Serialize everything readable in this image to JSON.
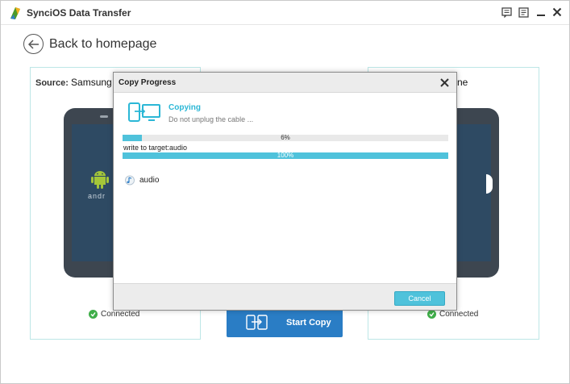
{
  "window": {
    "title": "SynciOS Data Transfer"
  },
  "nav": {
    "back_label": "Back to homepage"
  },
  "source_panel": {
    "label_prefix": "Source:",
    "device_name": "Samsung",
    "status": "Connected",
    "os_text": "andr"
  },
  "target_panel": {
    "label_suffix": "ne",
    "status": "Connected"
  },
  "start_copy": {
    "label": "Start Copy"
  },
  "dialog": {
    "title": "Copy Progress",
    "status_title": "Copying",
    "status_subtitle": "Do not unplug the cable ...",
    "overall_progress": 0.06,
    "overall_label": "6%",
    "task_label": "write to target:audio",
    "task_progress": 1.0,
    "task_label_pct": "100%",
    "items": [
      {
        "label": "audio",
        "icon": "music-note-icon"
      }
    ],
    "cancel_label": "Cancel"
  },
  "colors": {
    "accent": "#4fc2db",
    "copying_text": "#2bb7d6",
    "start_copy_bg": "#2a7dc5",
    "connected_green": "#3fae49",
    "panel_border": "#bde6e6"
  }
}
